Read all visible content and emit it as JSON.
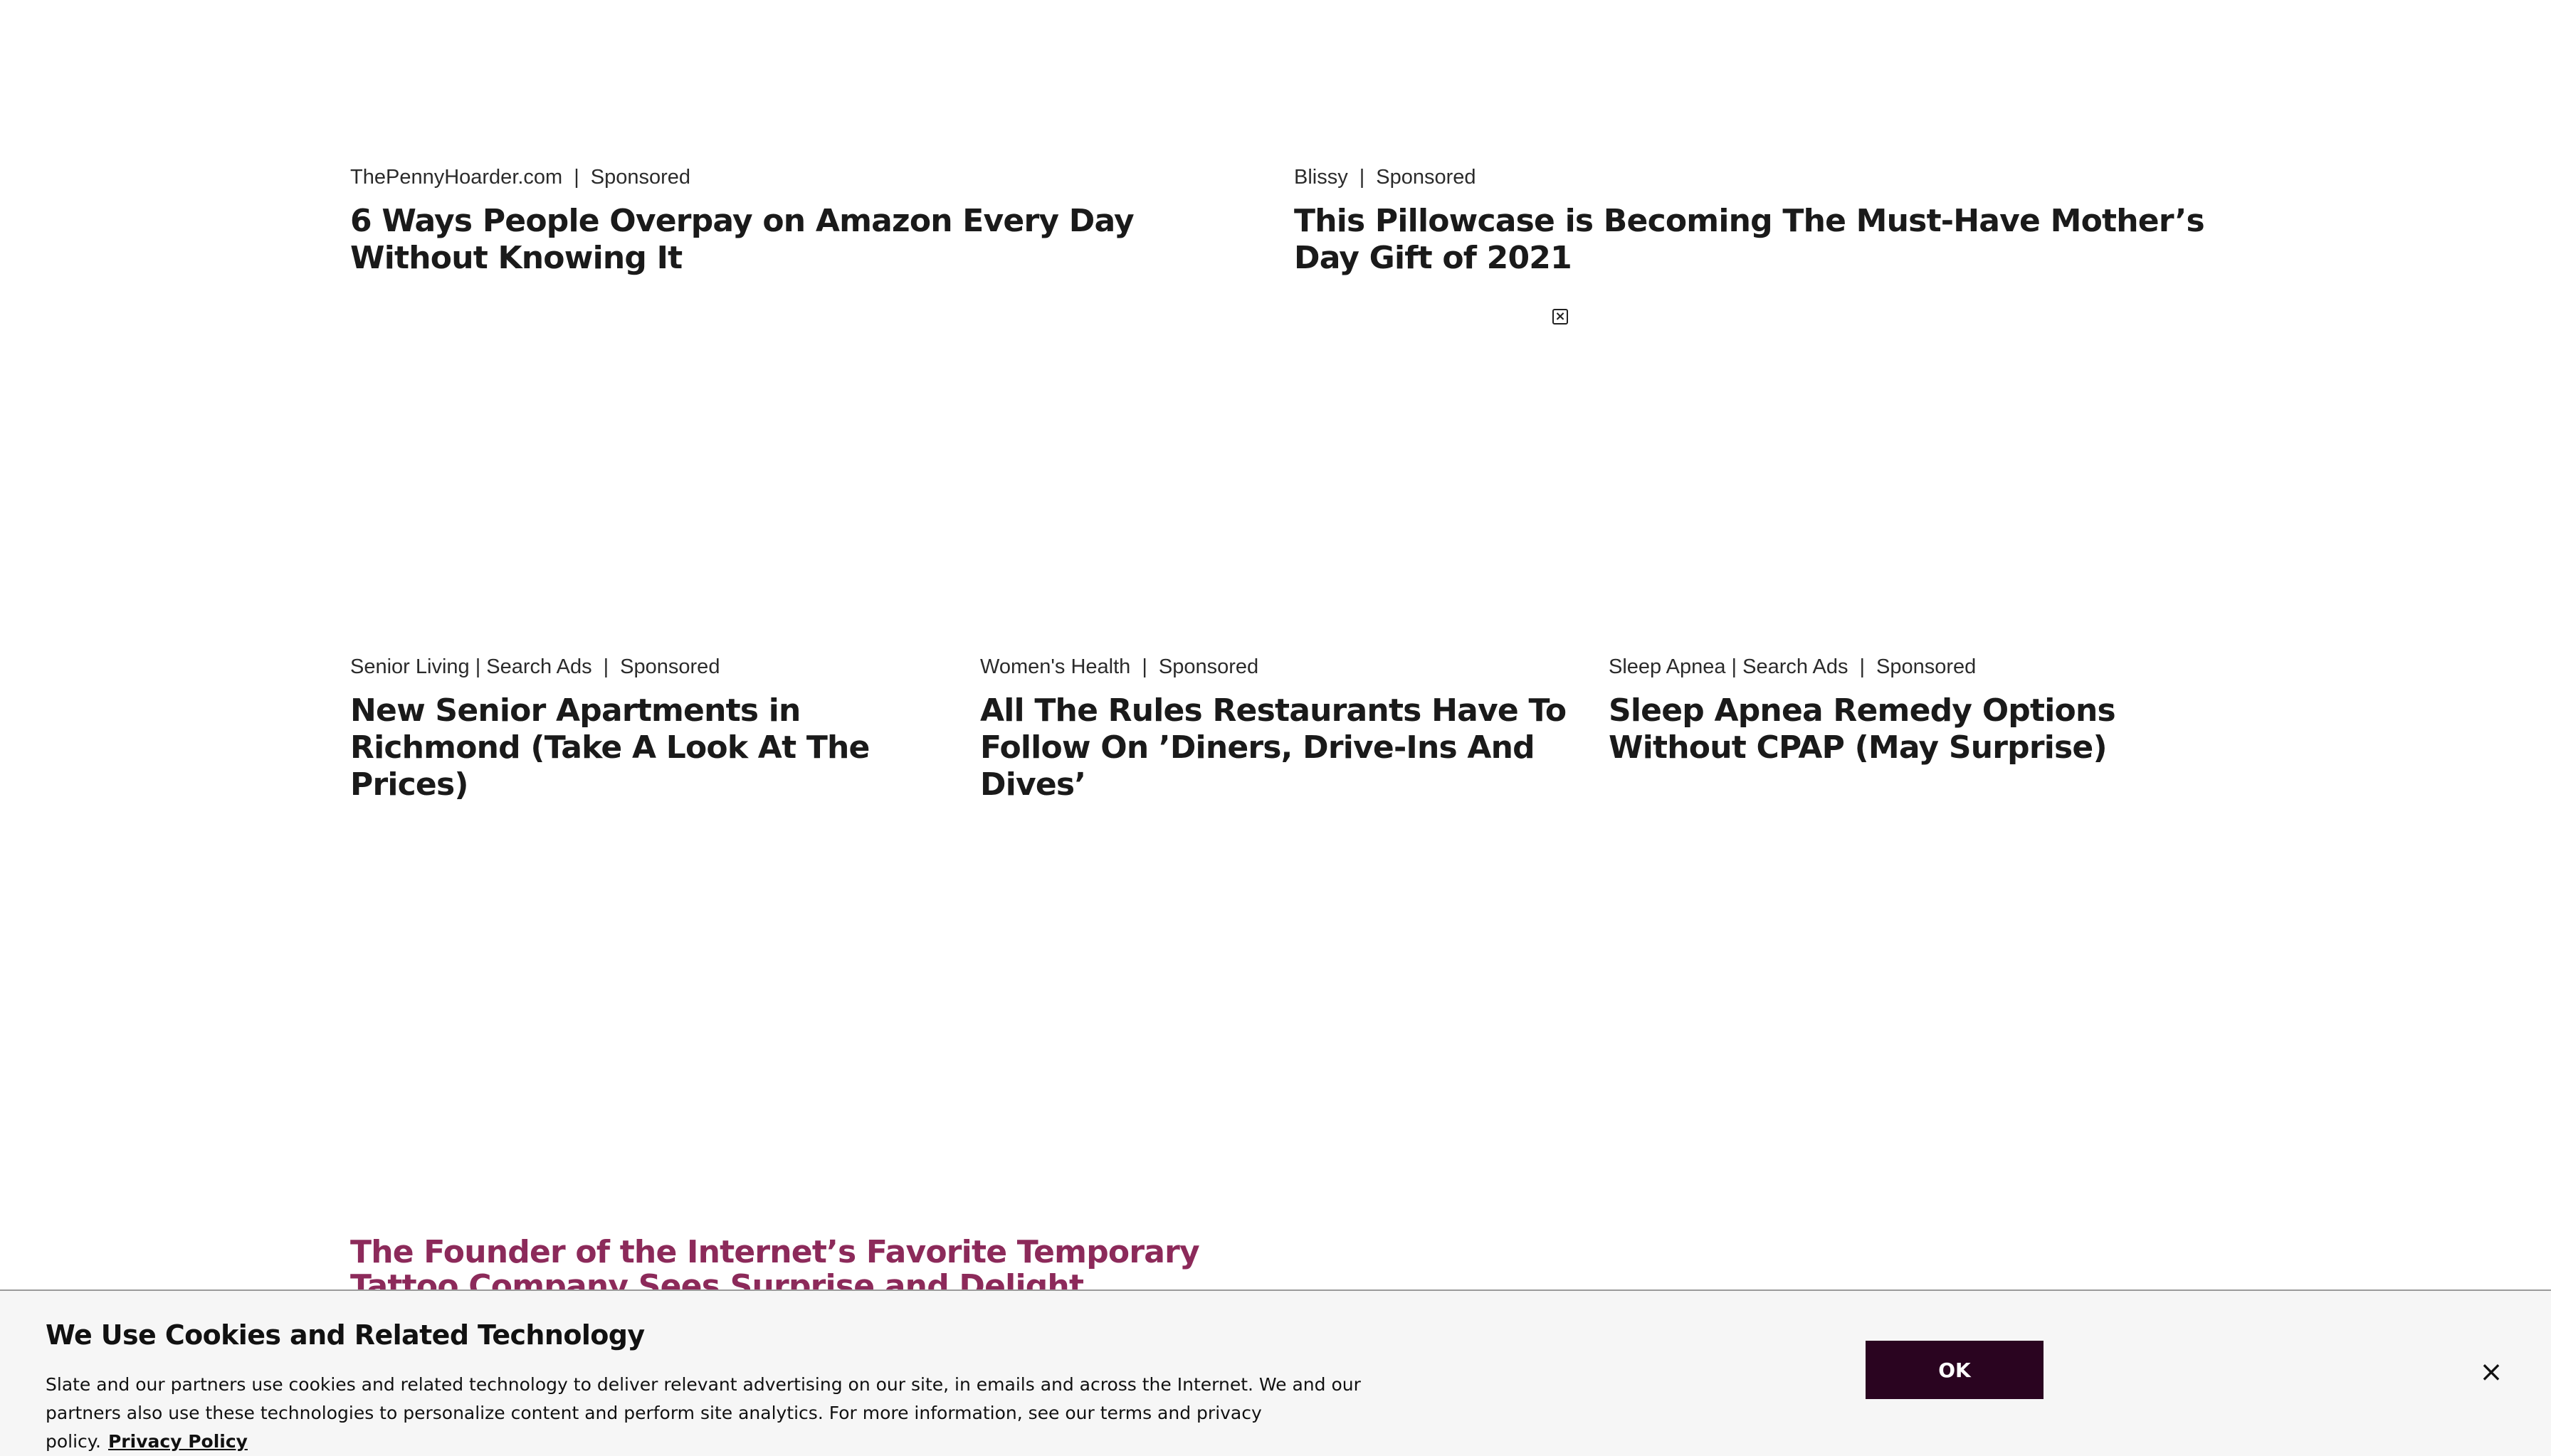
{
  "row1": [
    {
      "source": "ThePennyHoarder.com",
      "sponsored": "Sponsored",
      "headline": "6 Ways People Overpay on Amazon Every Day Without Knowing It"
    },
    {
      "source": "Blissy",
      "sponsored": "Sponsored",
      "headline": "This Pillowcase is Becoming The Must-Have Mother’s Day Gift of 2021"
    }
  ],
  "ad_close_icon": "close-box-icon",
  "row2": [
    {
      "source": "Senior Living | Search Ads",
      "sponsored": "Sponsored",
      "headline": "New Senior Apartments in Richmond (Take A Look At The Prices)"
    },
    {
      "source": "Women's Health",
      "sponsored": "Sponsored",
      "headline": "All The Rules Restaurants Have To Follow On ’Diners, Drive-Ins And Dives’"
    },
    {
      "source": "Sleep Apnea | Search Ads",
      "sponsored": "Sponsored",
      "headline": "Sleep Apnea Remedy Options Without CPAP (May Surprise)"
    }
  ],
  "feature": {
    "headline": "The Founder of the Internet’s Favorite Temporary Tattoo Company Sees Surprise and Delight Differently"
  },
  "separator": "|",
  "cookie_banner": {
    "title": "We Use Cookies and Related Technology",
    "text": "Slate and our partners use cookies and related technology to deliver relevant advertising on our site, in emails and across the Internet. We and our partners also use these technologies to personalize content and perform site analytics. For more information, see our terms and privacy policy.",
    "privacy_link": "Privacy Policy",
    "ok_label": "OK",
    "close_symbol": "×"
  },
  "colors": {
    "feature_headline": "#8c2a5a",
    "ok_button_bg": "#2a0420",
    "banner_bg": "#f6f6f6"
  }
}
